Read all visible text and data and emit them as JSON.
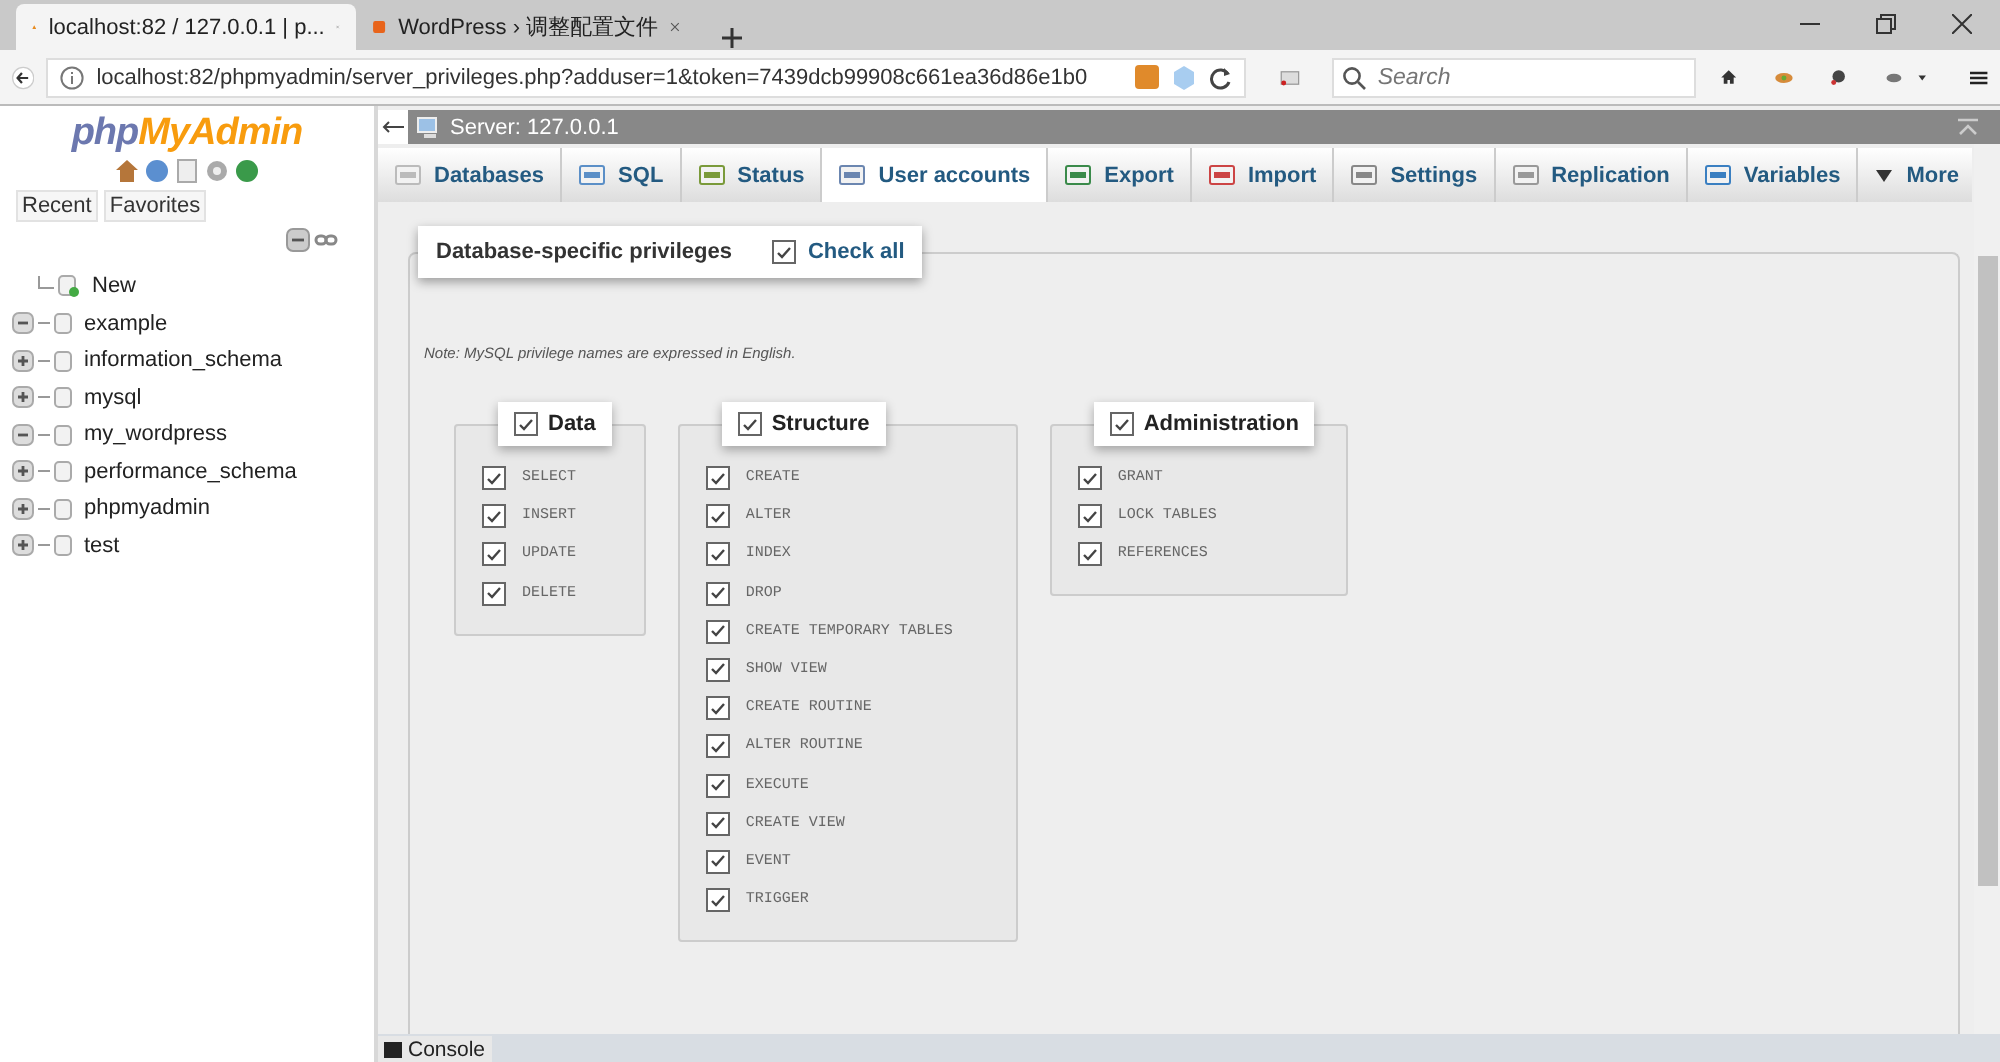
{
  "browser": {
    "tabs": [
      {
        "title": "localhost:82 / 127.0.0.1 | p...",
        "selected": true
      },
      {
        "title": "WordPress › 调整配置文件",
        "selected": false
      }
    ],
    "url": "localhost:82/phpmyadmin/server_privileges.php?adduser=1&token=7439dcb99908c661ea36d86e1b0",
    "search": {
      "placeholder": "Search"
    }
  },
  "sidebar": {
    "logo": {
      "php": "php",
      "myadmin": "MyAdmin"
    },
    "tabs": [
      "Recent",
      "Favorites"
    ],
    "tree": [
      {
        "label": "New",
        "kind": "new"
      },
      {
        "label": "example",
        "kind": "db",
        "expanded": true
      },
      {
        "label": "information_schema",
        "kind": "db",
        "expanded": false
      },
      {
        "label": "mysql",
        "kind": "db",
        "expanded": false
      },
      {
        "label": "my_wordpress",
        "kind": "db",
        "expanded": true
      },
      {
        "label": "performance_schema",
        "kind": "db",
        "expanded": false
      },
      {
        "label": "phpmyadmin",
        "kind": "db",
        "expanded": false
      },
      {
        "label": "test",
        "kind": "db",
        "expanded": false
      }
    ]
  },
  "server_bar": {
    "title": "Server: 127.0.0.1"
  },
  "tabs": [
    {
      "label": "Databases",
      "selected": false
    },
    {
      "label": "SQL",
      "selected": false
    },
    {
      "label": "Status",
      "selected": false
    },
    {
      "label": "User accounts",
      "selected": true
    },
    {
      "label": "Export",
      "selected": false
    },
    {
      "label": "Import",
      "selected": false
    },
    {
      "label": "Settings",
      "selected": false
    },
    {
      "label": "Replication",
      "selected": false
    },
    {
      "label": "Variables",
      "selected": false
    },
    {
      "label": "More",
      "selected": false
    }
  ],
  "privileges": {
    "title": "Database-specific privileges",
    "check_all": {
      "label": "Check all",
      "checked": true
    },
    "note": "Note: MySQL privilege names are expressed in English.",
    "groups": [
      {
        "title": "Data",
        "checked": true,
        "items": [
          {
            "label": "SELECT",
            "checked": true
          },
          {
            "label": "INSERT",
            "checked": true
          },
          {
            "label": "UPDATE",
            "checked": true
          },
          {
            "label": "DELETE",
            "checked": true
          }
        ]
      },
      {
        "title": "Structure",
        "checked": true,
        "items": [
          {
            "label": "CREATE",
            "checked": true
          },
          {
            "label": "ALTER",
            "checked": true
          },
          {
            "label": "INDEX",
            "checked": true
          },
          {
            "label": "DROP",
            "checked": true
          },
          {
            "label": "CREATE TEMPORARY TABLES",
            "checked": true
          },
          {
            "label": "SHOW VIEW",
            "checked": true
          },
          {
            "label": "CREATE ROUTINE",
            "checked": true
          },
          {
            "label": "ALTER ROUTINE",
            "checked": true
          },
          {
            "label": "EXECUTE",
            "checked": true
          },
          {
            "label": "CREATE VIEW",
            "checked": true
          },
          {
            "label": "EVENT",
            "checked": true
          },
          {
            "label": "TRIGGER",
            "checked": true
          }
        ]
      },
      {
        "title": "Administration",
        "checked": true,
        "items": [
          {
            "label": "GRANT",
            "checked": true
          },
          {
            "label": "LOCK TABLES",
            "checked": true
          },
          {
            "label": "REFERENCES",
            "checked": true
          }
        ]
      }
    ]
  },
  "console": {
    "label": "Console"
  }
}
